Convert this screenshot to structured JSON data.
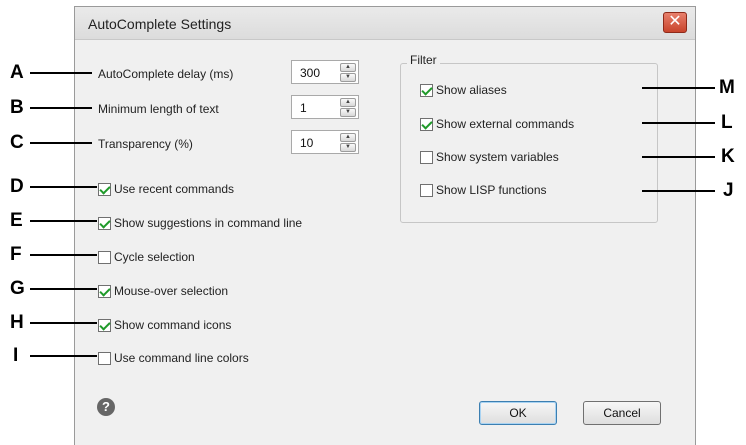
{
  "dialog": {
    "title": "AutoComplete Settings",
    "close_symbol": "✕"
  },
  "settings": {
    "delay_label": "AutoComplete delay (ms)",
    "delay_value": "300",
    "min_length_label": "Minimum length of text",
    "min_length_value": "1",
    "transparency_label": "Transparency (%)",
    "transparency_value": "10"
  },
  "options": [
    {
      "label": "Use recent commands",
      "checked": true
    },
    {
      "label": "Show suggestions in command line",
      "checked": true
    },
    {
      "label": "Cycle selection",
      "checked": false
    },
    {
      "label": "Mouse-over selection",
      "checked": true
    },
    {
      "label": "Show command icons",
      "checked": true
    },
    {
      "label": "Use command line colors",
      "checked": false
    }
  ],
  "filter": {
    "legend": "Filter",
    "items": [
      {
        "label": "Show aliases",
        "checked": true
      },
      {
        "label": "Show external commands",
        "checked": true
      },
      {
        "label": "Show system variables",
        "checked": false
      },
      {
        "label": "Show LISP functions",
        "checked": false
      }
    ]
  },
  "buttons": {
    "ok": "OK",
    "cancel": "Cancel",
    "help_symbol": "?"
  },
  "callouts": {
    "left": [
      "A",
      "B",
      "C",
      "D",
      "E",
      "F",
      "G",
      "H",
      "I"
    ],
    "right": [
      "M",
      "L",
      "K",
      "J"
    ]
  },
  "colors": {
    "check": "#1f9a2a",
    "close_button": "#c8442c",
    "ok_border": "#3c7fb1"
  }
}
